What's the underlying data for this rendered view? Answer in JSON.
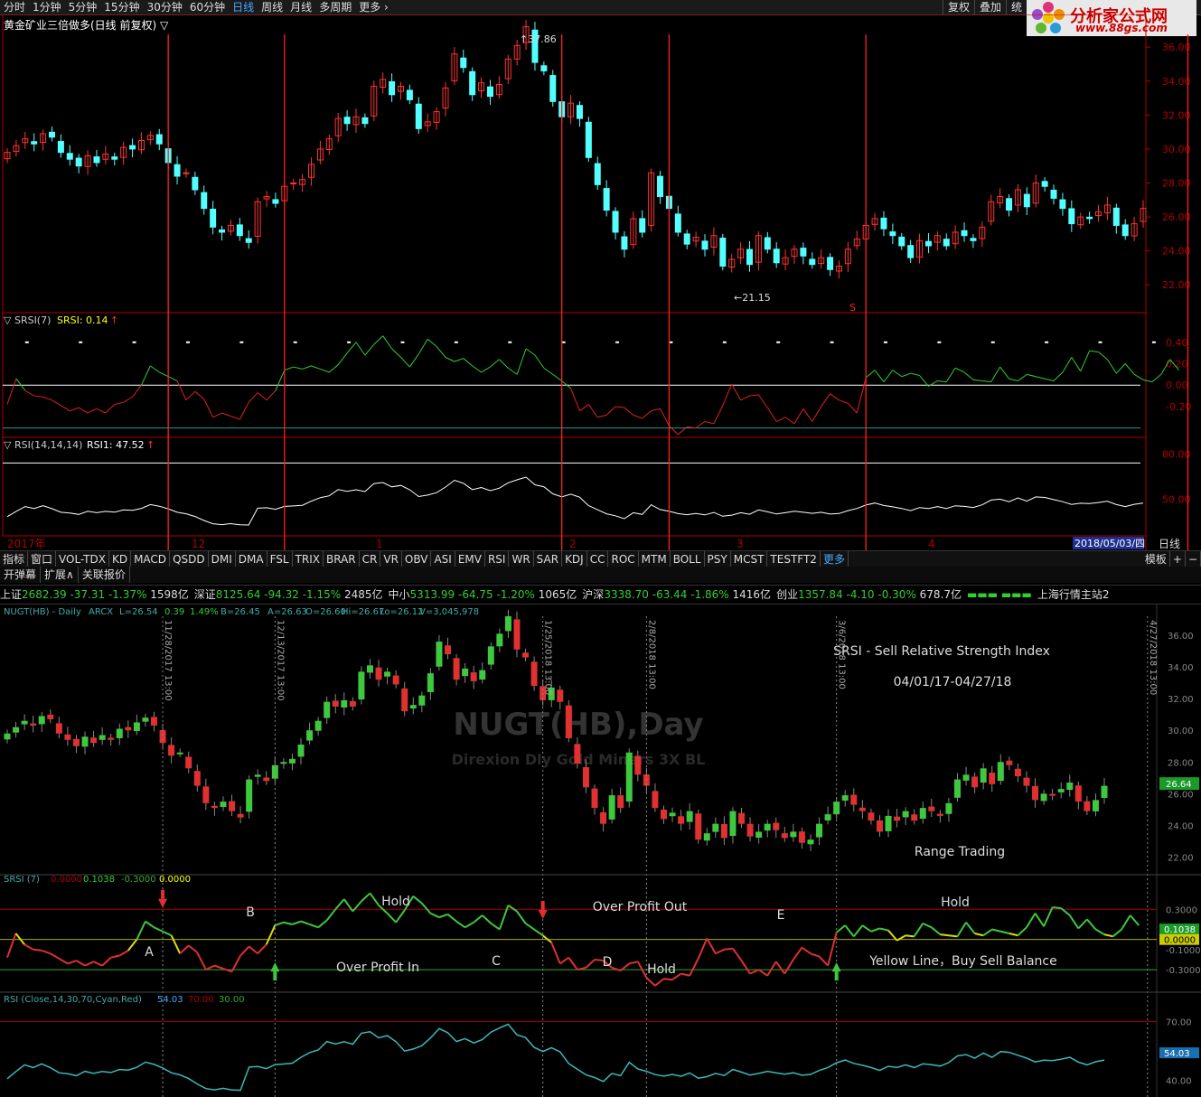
{
  "topbar": {
    "tabs": [
      "分时",
      "1分钟",
      "5分钟",
      "15分钟",
      "30分钟",
      "60分钟",
      "日线",
      "周线",
      "月线",
      "多周期",
      "更多 ›"
    ],
    "active": "日线",
    "right_buttons": [
      "复权",
      "叠加",
      "统"
    ]
  },
  "logo": {
    "line1": "分析家公式网",
    "line2": "www.88gs.com"
  },
  "main_title": "黄金矿业三倍做多(日线 前复权) ▽",
  "colors": {
    "up": "#ff3232",
    "down": "#54ffff",
    "grid": "#b00000",
    "marker": "#ff2020"
  },
  "chart_data": [
    {
      "type": "candlestick",
      "panel": "price",
      "ylim": [
        21,
        37.5
      ],
      "yticks": [
        "36.00",
        "34.00",
        "32.00",
        "30.00",
        "28.00",
        "26.00",
        "24.00",
        "22.00"
      ],
      "annotations": {
        "high_label": "37.86",
        "low_label": "21.15",
        "signal_mark": "S"
      },
      "closes": [
        29.8,
        30.2,
        30.6,
        30.3,
        30.9,
        30.7,
        29.8,
        29.4,
        29.0,
        29.6,
        29.2,
        29.7,
        29.4,
        30.1,
        30.0,
        30.5,
        30.8,
        30.3,
        29.2,
        28.4,
        28.6,
        27.6,
        26.5,
        25.4,
        25.1,
        25.5,
        24.9,
        24.5,
        26.9,
        27.2,
        26.8,
        27.8,
        28.0,
        28.2,
        29.1,
        30.0,
        30.6,
        31.8,
        31.5,
        31.9,
        31.5,
        33.7,
        34.1,
        33.2,
        33.7,
        32.9,
        31.2,
        31.6,
        32.2,
        33.6,
        35.6,
        34.8,
        33.2,
        33.9,
        33.1,
        33.8,
        35.3,
        36.1,
        37.2,
        35.1,
        34.6,
        32.8,
        31.9,
        32.7,
        31.8,
        29.5,
        27.9,
        26.4,
        25.1,
        24.1,
        25.9,
        25.1,
        28.6,
        27.2,
        26.5,
        25.1,
        24.4,
        24.8,
        24.1,
        24.9,
        23.1,
        23.5,
        24.1,
        23.2,
        24.9,
        24.1,
        23.3,
        23.6,
        24.1,
        23.7,
        23.2,
        23.6,
        22.9,
        23.1,
        24.1,
        24.7,
        25.5,
        25.9,
        25.3,
        24.9,
        24.3,
        23.6,
        24.6,
        24.3,
        24.9,
        24.3,
        25.1,
        24.9,
        24.6,
        25.4,
        26.9,
        27.2,
        26.4,
        27.6,
        26.6,
        28.0,
        27.8,
        27.1,
        26.5,
        25.6,
        26.0,
        25.9,
        26.3,
        26.7,
        25.5,
        24.9,
        25.6,
        26.5
      ],
      "event_lines_index": [
        18,
        31,
        62,
        74,
        96,
        132
      ]
    },
    {
      "type": "line",
      "panel": "srsi",
      "header": {
        "name": "▽ SRSI(7)",
        "label": "SRSI: 0.14",
        "arrow": "↑"
      },
      "ylim": [
        -0.42,
        0.55
      ],
      "yticks": [
        "0.40",
        "0.20",
        "0.00",
        "-0.20"
      ],
      "ref_lines": [
        0.0,
        0.4,
        -0.4
      ],
      "values": [
        -0.18,
        0.06,
        -0.05,
        -0.1,
        -0.11,
        -0.14,
        -0.19,
        -0.24,
        -0.21,
        -0.26,
        -0.22,
        -0.26,
        -0.18,
        -0.16,
        -0.11,
        0.0,
        0.18,
        0.12,
        0.08,
        0.04,
        -0.14,
        -0.06,
        -0.13,
        -0.3,
        -0.26,
        -0.29,
        -0.32,
        -0.16,
        -0.07,
        -0.14,
        -0.05,
        0.14,
        0.17,
        0.15,
        0.18,
        0.15,
        0.12,
        0.19,
        0.3,
        0.4,
        0.28,
        0.38,
        0.46,
        0.34,
        0.26,
        0.17,
        0.29,
        0.43,
        0.36,
        0.26,
        0.22,
        0.25,
        0.18,
        0.12,
        0.17,
        0.24,
        0.16,
        0.1,
        0.34,
        0.28,
        0.16,
        0.1,
        0.04,
        -0.03,
        -0.24,
        -0.18,
        -0.3,
        -0.28,
        -0.2,
        -0.21,
        -0.28,
        -0.31,
        -0.24,
        -0.22,
        -0.38,
        -0.46,
        -0.39,
        -0.4,
        -0.34,
        -0.36,
        -0.19,
        0.01,
        -0.14,
        -0.1,
        -0.09,
        -0.21,
        -0.34,
        -0.3,
        -0.36,
        -0.22,
        -0.34,
        -0.2,
        -0.08,
        -0.14,
        -0.17,
        -0.26,
        0.07,
        0.14,
        0.03,
        0.14,
        0.08,
        0.11,
        0.09,
        -0.01,
        0.04,
        0.03,
        0.16,
        0.12,
        0.05,
        0.04,
        0.03,
        0.17,
        0.06,
        0.04,
        0.1,
        0.08,
        0.06,
        0.04,
        0.12,
        0.26,
        0.13,
        0.32,
        0.31,
        0.24,
        0.11,
        0.2,
        0.1,
        0.05,
        0.03,
        0.1,
        0.24,
        0.14
      ]
    },
    {
      "type": "line",
      "panel": "rsi",
      "header": {
        "name": "▽ RSI(14,14,14)",
        "label": "RSI1: 47.52",
        "arrow": "↑"
      },
      "ylim": [
        30,
        85
      ],
      "yticks": [
        "80.00",
        "50.00"
      ],
      "ref_lines": [
        74
      ],
      "values": [
        38.5,
        42.0,
        45.2,
        43.9,
        45.7,
        43.8,
        41.4,
        40.9,
        40.0,
        42.1,
        41.1,
        42.0,
        41.5,
        43.0,
        42.7,
        44.0,
        46.5,
        45.4,
        43.7,
        41.4,
        40.4,
        38.6,
        36.0,
        33.8,
        33.2,
        33.9,
        33.1,
        33.0,
        44.1,
        44.4,
        43.4,
        45.3,
        45.6,
        46.0,
        48.8,
        51.1,
        52.3,
        56.4,
        55.2,
        56.3,
        55.1,
        60.4,
        61.1,
        58.2,
        59.2,
        56.3,
        51.8,
        52.8,
        54.4,
        58.1,
        62.6,
        60.6,
        56.4,
        57.8,
        55.7,
        57.3,
        60.9,
        62.9,
        64.7,
        59.6,
        58.3,
        53.6,
        51.6,
        53.4,
        51.4,
        45.8,
        43.1,
        40.4,
        39.1,
        37.2,
        41.1,
        40.0,
        46.4,
        43.2,
        42.1,
        40.5,
        39.8,
        40.6,
        39.7,
        41.3,
        38.8,
        39.5,
        41.1,
        40.1,
        43.0,
        41.7,
        40.3,
        41.1,
        42.1,
        41.4,
        40.7,
        41.4,
        40.2,
        40.6,
        42.5,
        43.9,
        46.2,
        47.5,
        45.9,
        45.0,
        43.9,
        42.5,
        44.5,
        43.9,
        45.2,
        43.9,
        45.7,
        45.3,
        44.6,
        46.3,
        49.5,
        50.1,
        48.4,
        50.9,
        48.8,
        51.6,
        51.2,
        49.8,
        48.4,
        46.6,
        47.4,
        47.2,
        47.9,
        48.8,
        46.5,
        45.2,
        46.7,
        47.5
      ]
    }
  ],
  "month_labels": [
    "2017年",
    "12",
    "1",
    "2",
    "3",
    "4"
  ],
  "date_badge": "2018/05/03/四",
  "period_label": "日线",
  "indicator_tabs": [
    "指标",
    "窗口",
    "VOL-TDX",
    "KD",
    "MACD",
    "QSDD",
    "DMI",
    "DMA",
    "FSL",
    "TRIX",
    "BRAR",
    "CR",
    "VR",
    "OBV",
    "ASI",
    "EMV",
    "RSI",
    "WR",
    "SAR",
    "KDJ",
    "CC",
    "ROC",
    "MTM",
    "BOLL",
    "PSY",
    "MCST",
    "TESTFT2",
    "更多"
  ],
  "template_tabs": [
    "模板",
    "+",
    "−"
  ],
  "row2_tabs": [
    "开弹幕",
    "扩展∧",
    "关联报价"
  ],
  "ticker": [
    {
      "name": "上证",
      "value": "2682.39",
      "chg": "-37.31",
      "pct": "-1.37%",
      "amt": "1598亿"
    },
    {
      "name": "深证",
      "value": "8125.64",
      "chg": "-94.32",
      "pct": "-1.15%",
      "amt": "2485亿"
    },
    {
      "name": "中小",
      "value": "5313.99",
      "chg": "-64.75",
      "pct": "-1.20%",
      "amt": "1065亿"
    },
    {
      "name": "沪深",
      "value": "3338.70",
      "chg": "-63.44",
      "pct": "-1.86%",
      "amt": "1416亿"
    },
    {
      "name": "创业",
      "value": "1357.84",
      "chg": "-4.10",
      "pct": "-0.30%",
      "amt": "678.7亿"
    }
  ],
  "ticker_station": "上海行情主站2",
  "bottom": {
    "header": {
      "sym": "NUGT(HB) - Daily",
      "ind": "ARCX",
      "l": "L=26.54",
      "chg": "0.39",
      "pct": "1.49%",
      "b": "B=26.45",
      "a": "A=26.63",
      "o": "O=26.60",
      "hi": "Hi=26.67",
      "lo": "Lo=26.12",
      "v": "V=3,045,978"
    },
    "watermark": "NUGT(HB),Day",
    "watermark_sub": "Direxion Dly Gold Miners 3X BL",
    "title": "SRSI - Sell Relative Strength Index",
    "date_range": "04/01/17-04/27/18",
    "event_dates": [
      "11/28/2017 13:00",
      "12/13/2017 13:00",
      "1/25/2018 13:00",
      "2/8/2018 13:00",
      "3/6/2018 13:00",
      "4/27/2018 13:00"
    ],
    "yticks": [
      "36.00",
      "34.00",
      "32.00",
      "30.00",
      "28.00",
      "26.00",
      "24.00",
      "22.00"
    ],
    "last_price": "26.64",
    "range_label": "Range Trading",
    "srsi_header": {
      "name": "SRSI (7)",
      "v1": "0.0000",
      "v2": "0.1038",
      "v3": "-0.3000",
      "v4": "0.0000"
    },
    "srsi_yticks": [
      "0.3000",
      "-0.1000",
      "-0.3000"
    ],
    "srsi_badges": [
      "0.1038",
      "0.0000"
    ],
    "annotations": {
      "A": "A",
      "B": "B",
      "C": "C",
      "D": "D",
      "E": "E",
      "hold1": "Hold",
      "hold2": "Hold",
      "hold3": "Hold",
      "opo": "Over Profit Out",
      "opi": "Over Profit In",
      "yellow": "Yellow Line，Buy Sell Balance"
    },
    "rsi_header": {
      "name": "RSI (Close,14,30,70,Cyan,Red)",
      "v1": "54.03",
      "v2": "70.00",
      "v3": "30.00"
    },
    "rsi_yticks": [
      "70.00",
      "40.00"
    ],
    "rsi_badge": "54.03"
  }
}
